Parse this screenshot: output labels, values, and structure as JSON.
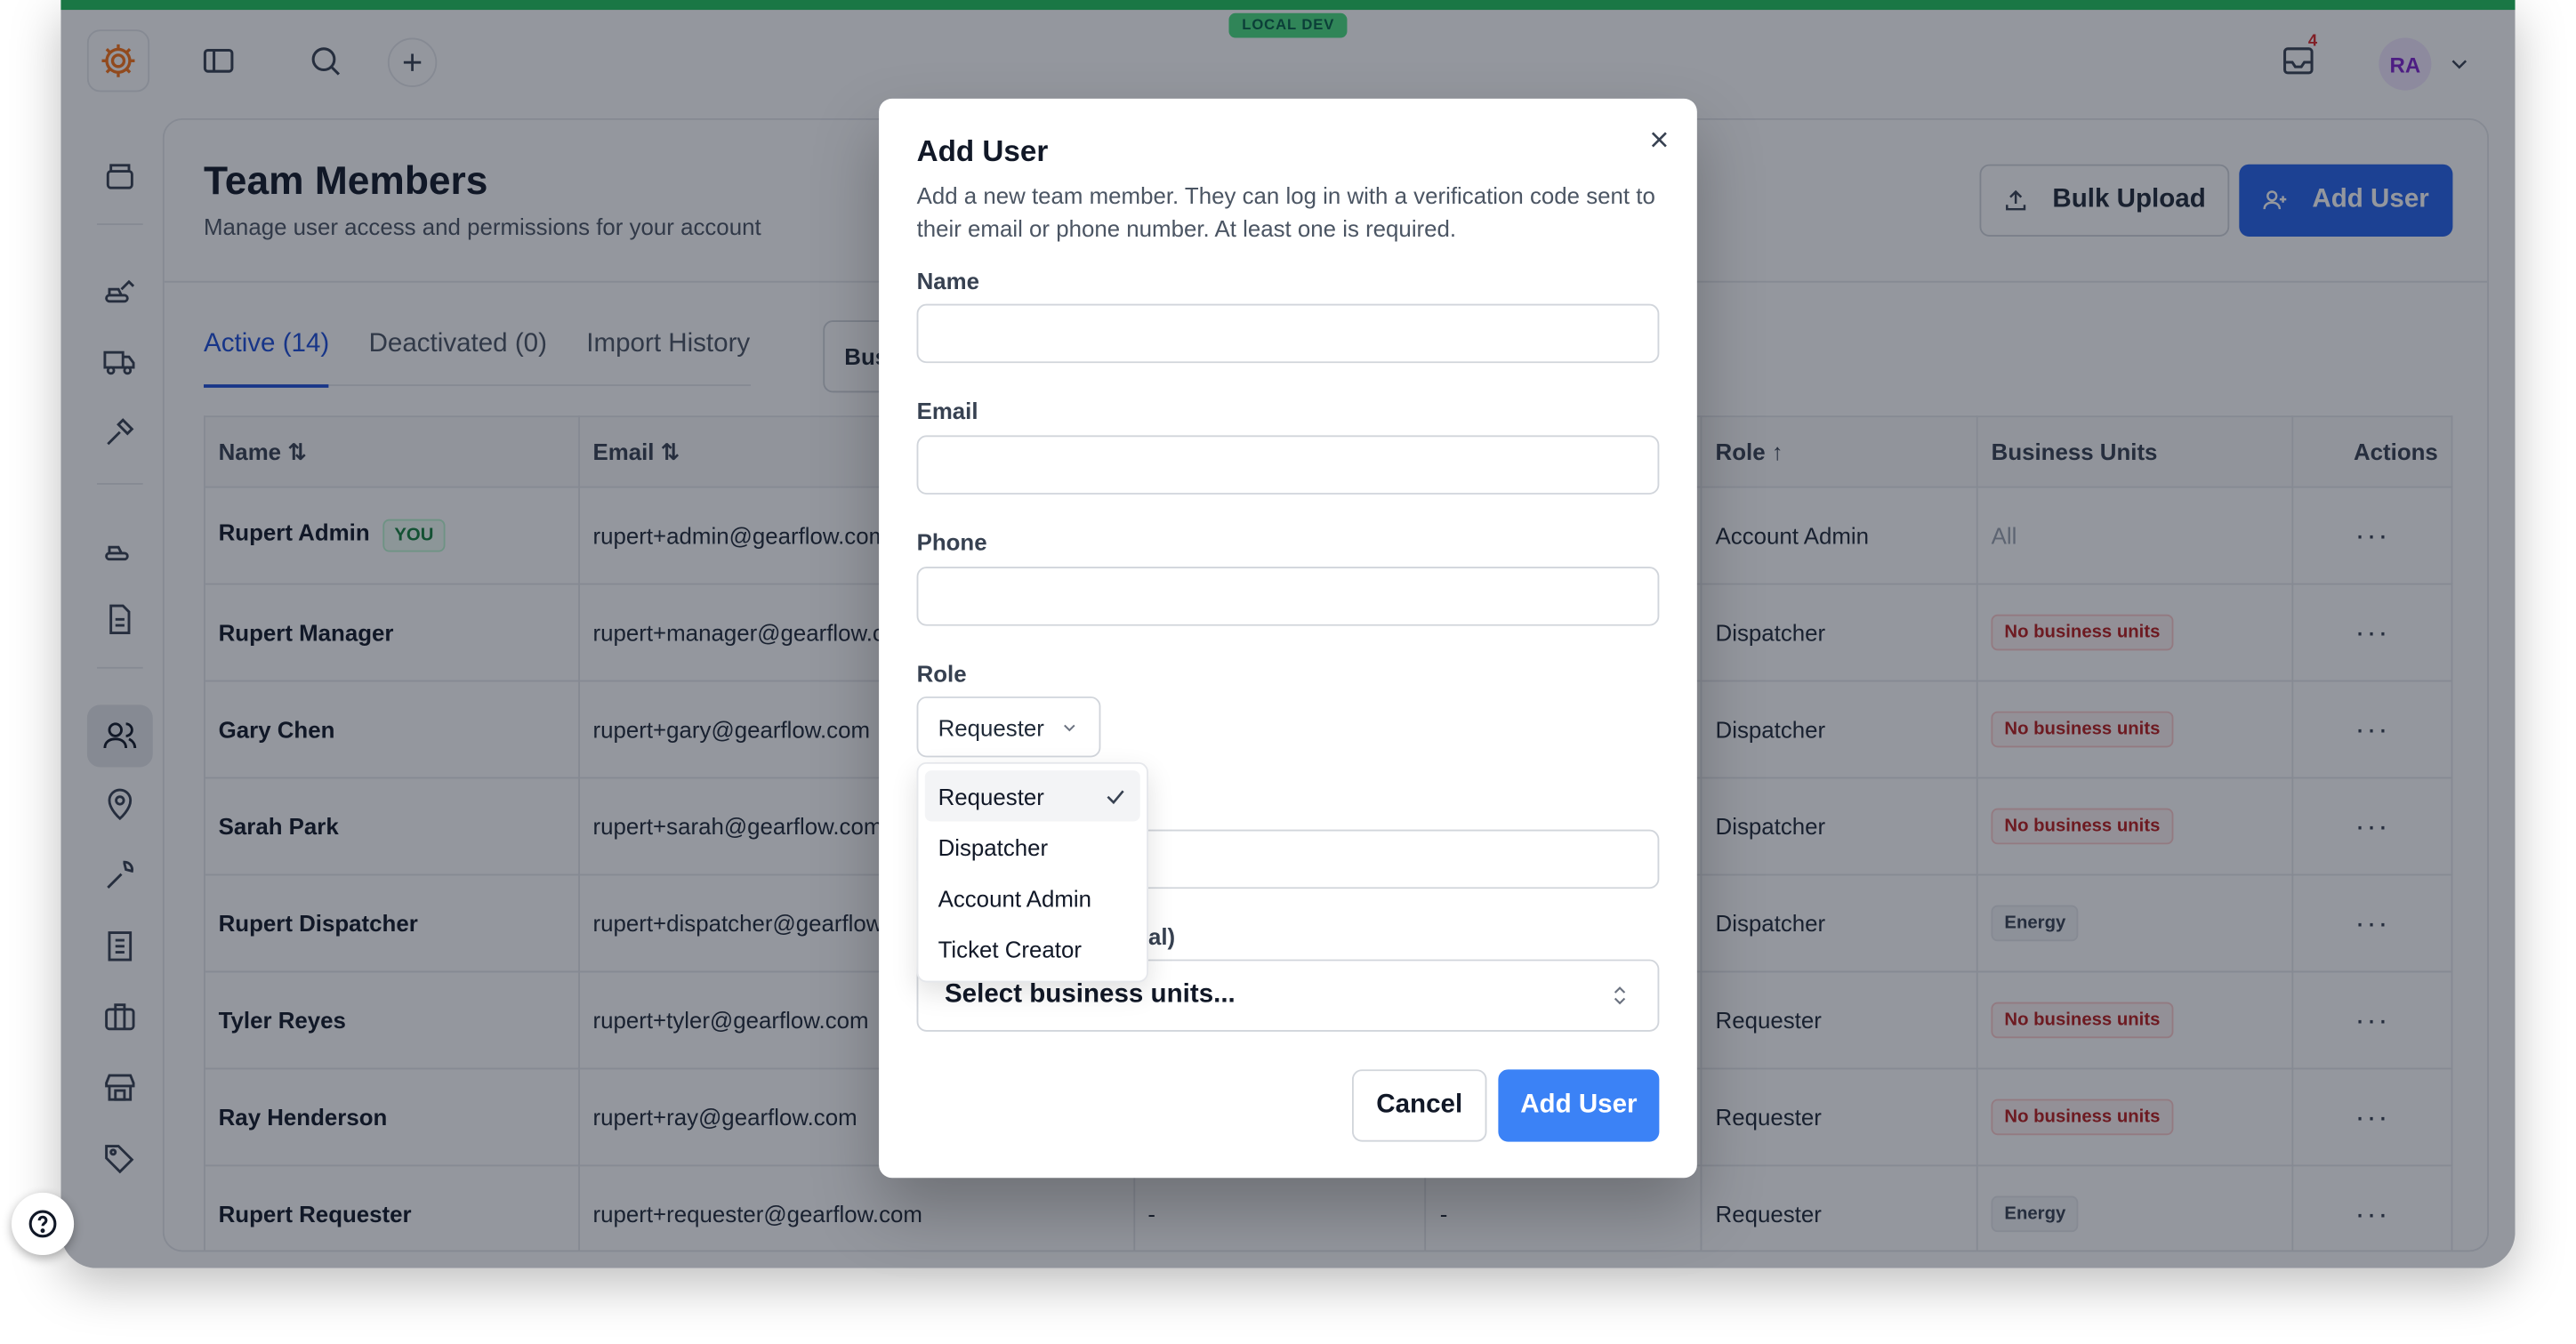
{
  "env_badge": "LOCAL DEV",
  "header": {
    "notifications_count": "4",
    "avatar_initials": "RA"
  },
  "page": {
    "title": "Team Members",
    "subtitle": "Manage user access and permissions for your account",
    "bulk_upload_label": "Bulk Upload",
    "add_user_label": "Add User",
    "filter_chip": "Bus"
  },
  "tabs": [
    {
      "label": "Active (14)",
      "active": true
    },
    {
      "label": "Deactivated (0)",
      "active": false
    },
    {
      "label": "Import History",
      "active": false
    }
  ],
  "table": {
    "headers": {
      "name": "Name",
      "email": "Email",
      "role": "Role",
      "business_units": "Business Units",
      "actions": "Actions"
    },
    "you_badge": "YOU",
    "rows": [
      {
        "name": "Rupert Admin",
        "email": "rupert+admin@gearflow.com",
        "col3": "",
        "col4": "",
        "role": "Account Admin",
        "bu": "All",
        "bu_style": "muted"
      },
      {
        "name": "Rupert Manager",
        "email": "rupert+manager@gearflow.com",
        "col3": "",
        "col4": "",
        "role": "Dispatcher",
        "bu": "No business units",
        "bu_style": "red"
      },
      {
        "name": "Gary Chen",
        "email": "rupert+gary@gearflow.com",
        "col3": "",
        "col4": "",
        "role": "Dispatcher",
        "bu": "No business units",
        "bu_style": "red"
      },
      {
        "name": "Sarah Park",
        "email": "rupert+sarah@gearflow.com",
        "col3": "",
        "col4": "",
        "role": "Dispatcher",
        "bu": "No business units",
        "bu_style": "red"
      },
      {
        "name": "Rupert Dispatcher",
        "email": "rupert+dispatcher@gearflow.com",
        "col3": "",
        "col4": "",
        "role": "Dispatcher",
        "bu": "Energy",
        "bu_style": "gray"
      },
      {
        "name": "Tyler Reyes",
        "email": "rupert+tyler@gearflow.com",
        "col3": "",
        "col4": "",
        "role": "Requester",
        "bu": "No business units",
        "bu_style": "red"
      },
      {
        "name": "Ray Henderson",
        "email": "rupert+ray@gearflow.com",
        "col3": "",
        "col4": "",
        "role": "Requester",
        "bu": "No business units",
        "bu_style": "red"
      },
      {
        "name": "Rupert Requester",
        "email": "rupert+requester@gearflow.com",
        "col3": "-",
        "col4": "-",
        "role": "Requester",
        "bu": "Energy",
        "bu_style": "gray"
      }
    ],
    "row_action": "···"
  },
  "modal": {
    "title": "Add User",
    "description": "Add a new team member. They can log in with a verification code sent to their email or phone number. At least one is required.",
    "name_label": "Name",
    "email_label": "Email",
    "phone_label": "Phone",
    "role_label": "Role",
    "role_value": "Requester",
    "bu_label_visible": "al)",
    "bu_placeholder": "Select business units...",
    "cancel_label": "Cancel",
    "submit_label": "Add User"
  },
  "role_dropdown": {
    "options": [
      "Requester",
      "Dispatcher",
      "Account Admin",
      "Ticket Creator"
    ],
    "selected": "Requester"
  },
  "colors": {
    "accent": "#2563eb",
    "env_bar": "#22c55e",
    "danger": "#b91c1c"
  }
}
